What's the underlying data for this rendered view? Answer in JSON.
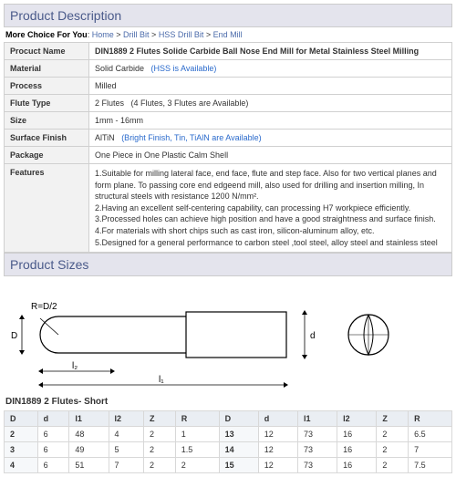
{
  "section1": "Product Description",
  "breadcrumb": {
    "label": "More Choice For You",
    "sep": ">",
    "items": [
      "Home",
      "Drill Bit",
      "HSS Drill Bit",
      "End Mill"
    ]
  },
  "desc": {
    "name_lbl": "Procuct Name",
    "name": "DIN1889 2 Flutes Solide Carbide Ball Nose End Mill for Metal Stainless Steel Milling",
    "material_lbl": "Material",
    "material": "Solid Carbide",
    "material_note": "(HSS is Available)",
    "process_lbl": "Process",
    "process": "Milled",
    "flute_lbl": "Flute Type",
    "flute": "2 Flutes",
    "flute_note": "(4 Flutes, 3 Flutes are Available)",
    "size_lbl": "Size",
    "size": "1mm - 16mm",
    "finish_lbl": "Surface Finish",
    "finish": "AlTiN",
    "finish_note": "(Bright Finish, Tin, TiAlN are Available)",
    "package_lbl": "Package",
    "package": "One Piece in One Plastic Calm Shell",
    "features_lbl": "Features",
    "features": "1.Suitable for milling lateral face, end face, flute and step face. Also for two vertical planes and form plane. To passing core end edgeend mill, also used for drilling and insertion milling, In structural steels with resistance 1200 N/mm².\n2.Having an excellent self-centering capability, can processing H7 workpiece efficiently.\n3.Processed holes can achieve high position and have a good straightness and surface finish.\n4.For materials with short chips such as cast iron, silicon-aluminum alloy, etc.\n5.Designed for a general performance to carbon steel ,tool steel, alloy steel and stainless steel"
  },
  "section2": "Product Sizes",
  "diagram_labels": {
    "R": "R=D/2",
    "D": "D",
    "d": "d",
    "l2": "l₂",
    "l1": "l₁"
  },
  "sizes_title": "DIN1889 2 Flutes- Short",
  "sizes_headers": [
    "D",
    "d",
    "l1",
    "l2",
    "Z",
    "R",
    "D",
    "d",
    "l1",
    "l2",
    "Z",
    "R"
  ],
  "sizes_rows": [
    [
      "2",
      "6",
      "48",
      "4",
      "2",
      "1",
      "13",
      "12",
      "73",
      "16",
      "2",
      "6.5"
    ],
    [
      "3",
      "6",
      "49",
      "5",
      "2",
      "1.5",
      "14",
      "12",
      "73",
      "16",
      "2",
      "7"
    ],
    [
      "4",
      "6",
      "51",
      "7",
      "2",
      "2",
      "15",
      "12",
      "73",
      "16",
      "2",
      "7.5"
    ]
  ]
}
